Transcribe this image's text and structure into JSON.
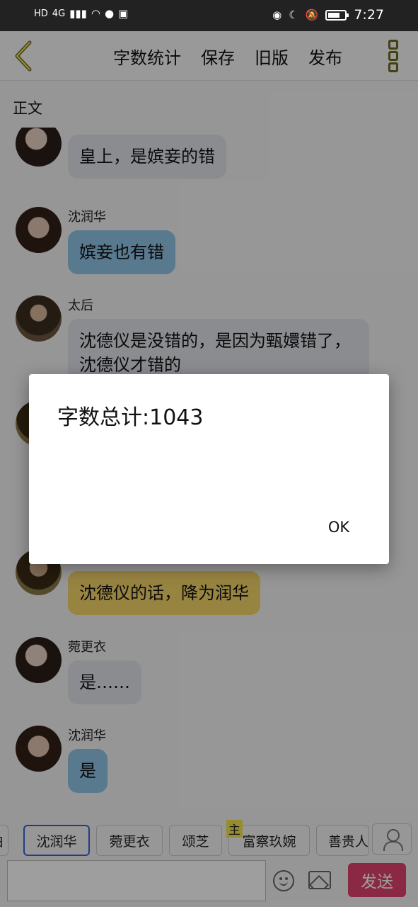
{
  "status_bar": {
    "network_label": "HD",
    "signal_label": "4G",
    "time": "7:27"
  },
  "toolbar": {
    "actions": [
      "字数统计",
      "保存",
      "旧版",
      "发布"
    ]
  },
  "section_label": "正文",
  "messages": [
    {
      "name": "",
      "text": "皇上，是嫔妾的错",
      "color": "gray"
    },
    {
      "name": "沈润华",
      "text": "嫔妾也有错",
      "color": "blue"
    },
    {
      "name": "太后",
      "text": "沈德仪是没错的，是因为甄嬛错了，沈德仪才错的",
      "color": "gray"
    },
    {
      "name": "",
      "text": "沈德仪的话，降为润华",
      "color": "yellow"
    },
    {
      "name": "菀更衣",
      "text": "是……",
      "color": "gray"
    },
    {
      "name": "沈润华",
      "text": "是",
      "color": "blue"
    }
  ],
  "role_chips": {
    "items": [
      "白",
      "沈润华",
      "菀更衣",
      "颂芝",
      "富察玖婉",
      "善贵人"
    ],
    "active_index": 1,
    "main_badge": "主"
  },
  "input": {
    "send_label": "发送"
  },
  "dialog": {
    "title": "字数总计:1043",
    "ok_label": "OK"
  }
}
